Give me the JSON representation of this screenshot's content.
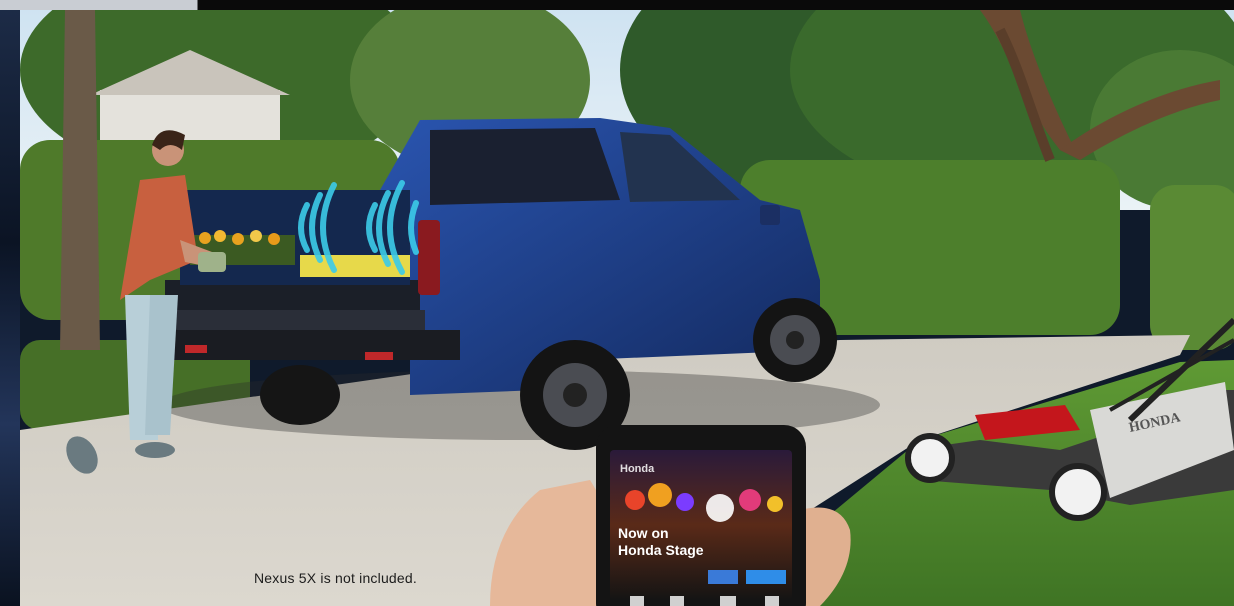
{
  "caption": "Nexus 5X is not included.",
  "phone": {
    "headline_line1": "Now on",
    "headline_line2": "Honda Stage",
    "app_brand": "Honda"
  },
  "mower_brand": "HONDA",
  "colors": {
    "truck_blue": "#1d3f8c",
    "mower_red": "#c4161c",
    "hedge_green": "#4f7a2a",
    "driveway": "#d6d2c9",
    "lawn": "#4e8a2c"
  }
}
